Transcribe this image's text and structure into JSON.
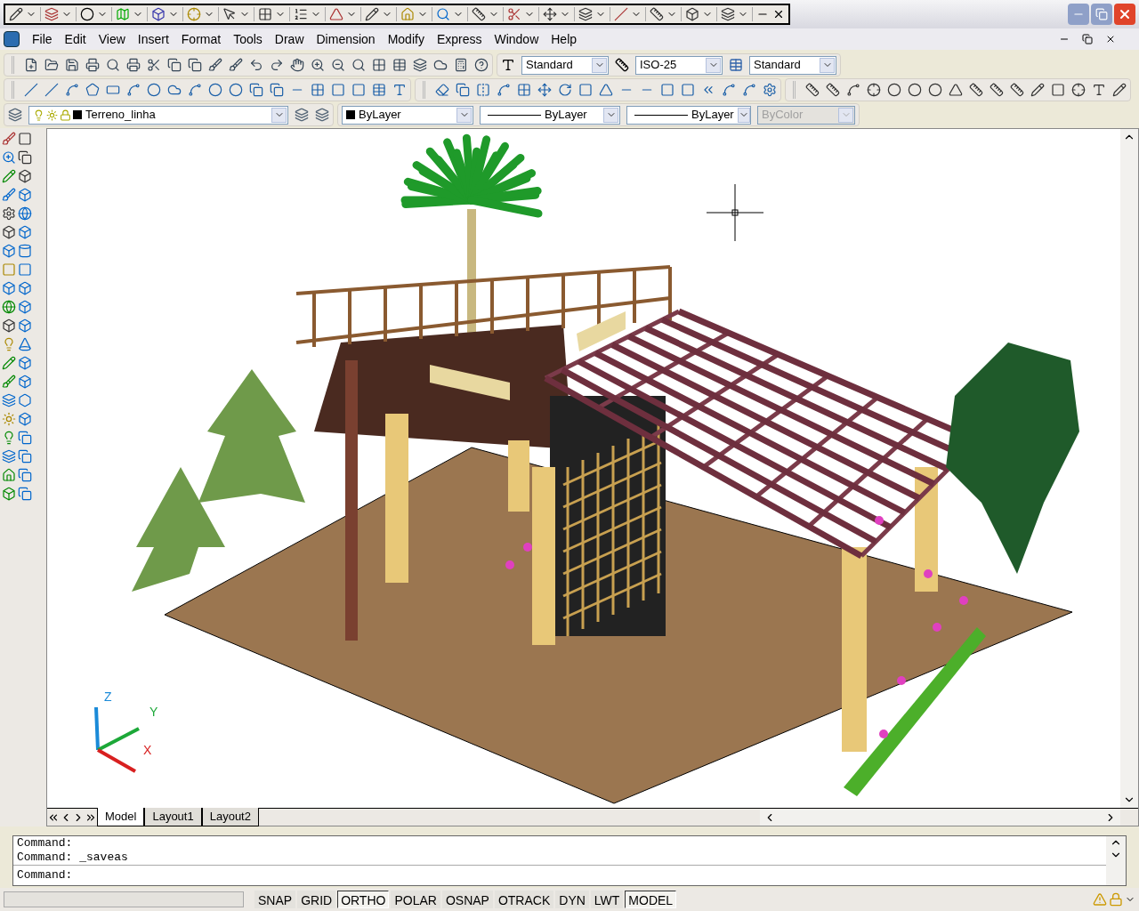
{
  "menu_bar": {
    "items": [
      "File",
      "Edit",
      "View",
      "Insert",
      "Format",
      "Tools",
      "Draw",
      "Dimension",
      "Modify",
      "Express",
      "Window",
      "Help"
    ]
  },
  "styles_toolbar": {
    "text_style": "Standard",
    "dimension_style": "ISO-25",
    "table_style": "Standard"
  },
  "layers_toolbar": {
    "layer": "Terreno_linha"
  },
  "properties_toolbar": {
    "color_setting": "ByLayer",
    "linetype": "ByLayer",
    "lineweight": "ByLayer",
    "plot_style": {
      "value": "ByColor",
      "disabled": true
    }
  },
  "ucs_icon": {
    "z_label": "Z",
    "y_label": "Y",
    "x_label": "X"
  },
  "layout_tabs": [
    {
      "label": "Model",
      "selected": true
    },
    {
      "label": "Layout1",
      "selected": false
    },
    {
      "label": "Layout2",
      "selected": false
    }
  ],
  "command_window": {
    "history": [
      "Command:",
      "Command: _saveas"
    ],
    "prompt": "Command:"
  },
  "status_bar": {
    "toggles": [
      {
        "label": "SNAP",
        "on": false
      },
      {
        "label": "GRID",
        "on": false
      },
      {
        "label": "ORTHO",
        "on": true
      },
      {
        "label": "POLAR",
        "on": false
      },
      {
        "label": "OSNAP",
        "on": false
      },
      {
        "label": "OTRACK",
        "on": false
      },
      {
        "label": "DYN",
        "on": false
      },
      {
        "label": "LWT",
        "on": false
      },
      {
        "label": "MODEL",
        "on": true
      }
    ]
  }
}
